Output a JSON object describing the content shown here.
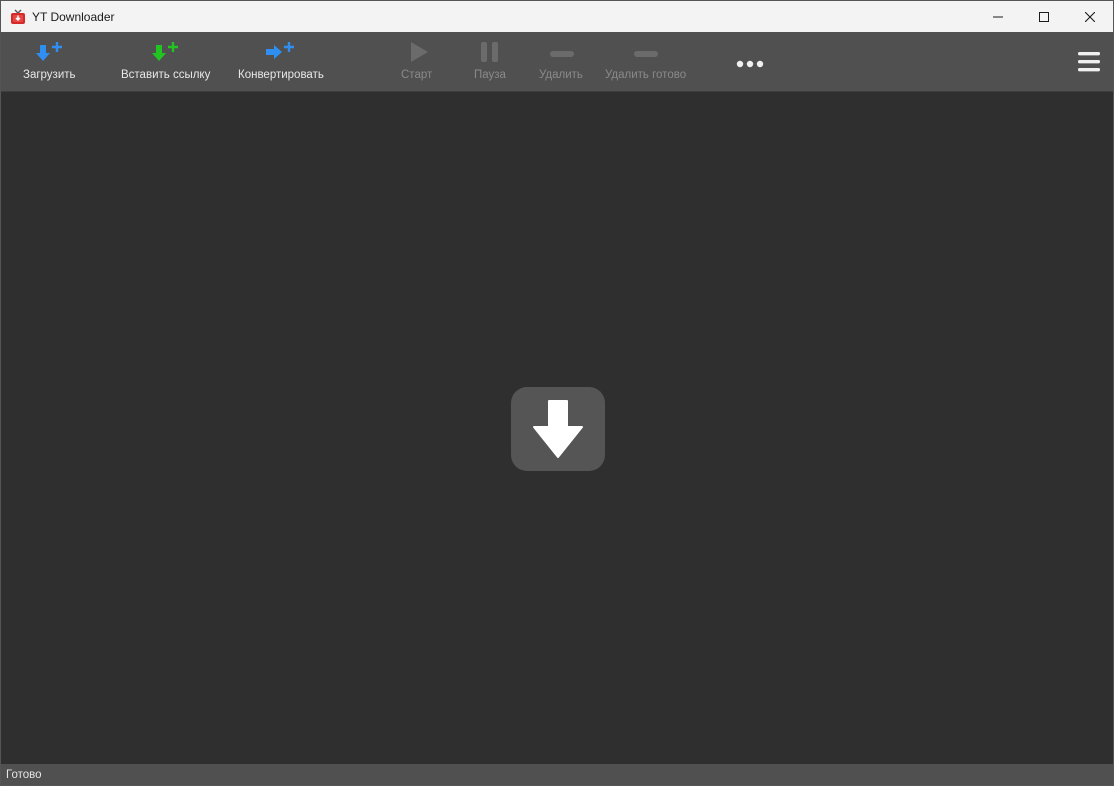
{
  "window": {
    "title": "YT Downloader",
    "app_icon": "tv-download-icon",
    "controls": [
      "minimize-icon",
      "maximize-icon",
      "close-icon"
    ]
  },
  "toolbar": {
    "download": {
      "label": "Загрузить",
      "icon": "download-plus-icon",
      "icon_color": "#2f8ff0"
    },
    "paste_link": {
      "label": "Вставить ссылку",
      "icon": "paste-link-plus-icon",
      "icon_color": "#22c422"
    },
    "convert": {
      "label": "Конвертировать",
      "icon": "convert-plus-icon",
      "icon_color": "#2f8ff0"
    },
    "start": {
      "label": "Старт",
      "icon": "play-icon",
      "enabled": false
    },
    "pause": {
      "label": "Пауза",
      "icon": "pause-icon",
      "enabled": false
    },
    "delete": {
      "label": "Удалить",
      "icon": "minus-icon",
      "enabled": false
    },
    "delete_done": {
      "label": "Удалить готово",
      "icon": "minus-icon",
      "enabled": false
    },
    "more": {
      "icon": "more-dots-icon"
    },
    "menu": {
      "icon": "hamburger-menu-icon"
    }
  },
  "content": {
    "empty_state_icon": "download-arrow-icon"
  },
  "status": {
    "text": "Готово"
  }
}
